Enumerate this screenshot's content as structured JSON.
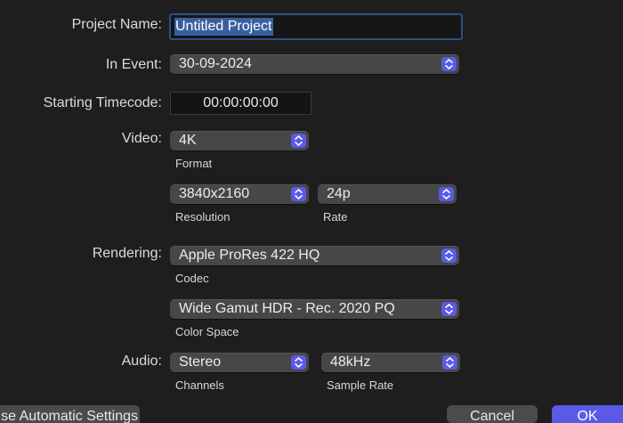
{
  "labels": {
    "project_name": "Project Name:",
    "in_event": "In Event:",
    "starting_timecode": "Starting Timecode:",
    "video": "Video:",
    "rendering": "Rendering:",
    "audio": "Audio:"
  },
  "fields": {
    "project_name": "Untitled Project",
    "event": "30-09-2024",
    "timecode": "00:00:00:00",
    "video_format": "4K",
    "resolution": "3840x2160",
    "rate": "24p",
    "codec": "Apple ProRes 422 HQ",
    "color_space": "Wide Gamut HDR - Rec. 2020 PQ",
    "channels": "Stereo",
    "sample_rate": "48kHz"
  },
  "sublabels": {
    "format": "Format",
    "resolution": "Resolution",
    "rate": "Rate",
    "codec": "Codec",
    "color_space": "Color Space",
    "channels": "Channels",
    "sample_rate": "Sample Rate"
  },
  "buttons": {
    "use_automatic": "se Automatic Settings",
    "cancel": "Cancel",
    "ok": "OK"
  },
  "colors": {
    "background": "#1e1e1e",
    "accent": "#5a5ae6",
    "selection": "#3a5f9f",
    "focus_ring": "#2f4f86",
    "popup": "#474747"
  }
}
